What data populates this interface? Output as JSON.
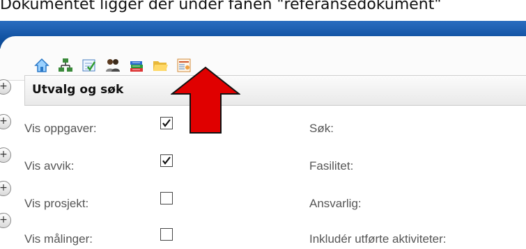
{
  "caption": "Dokumentet ligger der under fanen \"referansedokument\"",
  "toolbar": {
    "icons": [
      "home-icon",
      "network-icon",
      "checklist-icon",
      "users-icon",
      "books-icon",
      "folder-icon",
      "report-icon"
    ]
  },
  "panel": {
    "title": "Utvalg og søk",
    "left_rows": [
      {
        "label": "Vis oppgaver:",
        "checked": true
      },
      {
        "label": "Vis avvik:",
        "checked": true
      },
      {
        "label": "Vis prosjekt:",
        "checked": false
      },
      {
        "label": "Vis målinger:",
        "checked": false
      }
    ],
    "right_rows": [
      {
        "label": "Søk:"
      },
      {
        "label": "Fasilitet:"
      },
      {
        "label": "Ansvarlig:"
      },
      {
        "label": "Inkludér utførte aktiviteter:"
      }
    ]
  },
  "side_buttons": [
    "+",
    "+",
    "+",
    "+",
    "+"
  ],
  "colors": {
    "header": "#0f4f9e",
    "arrow": "#e00000"
  }
}
